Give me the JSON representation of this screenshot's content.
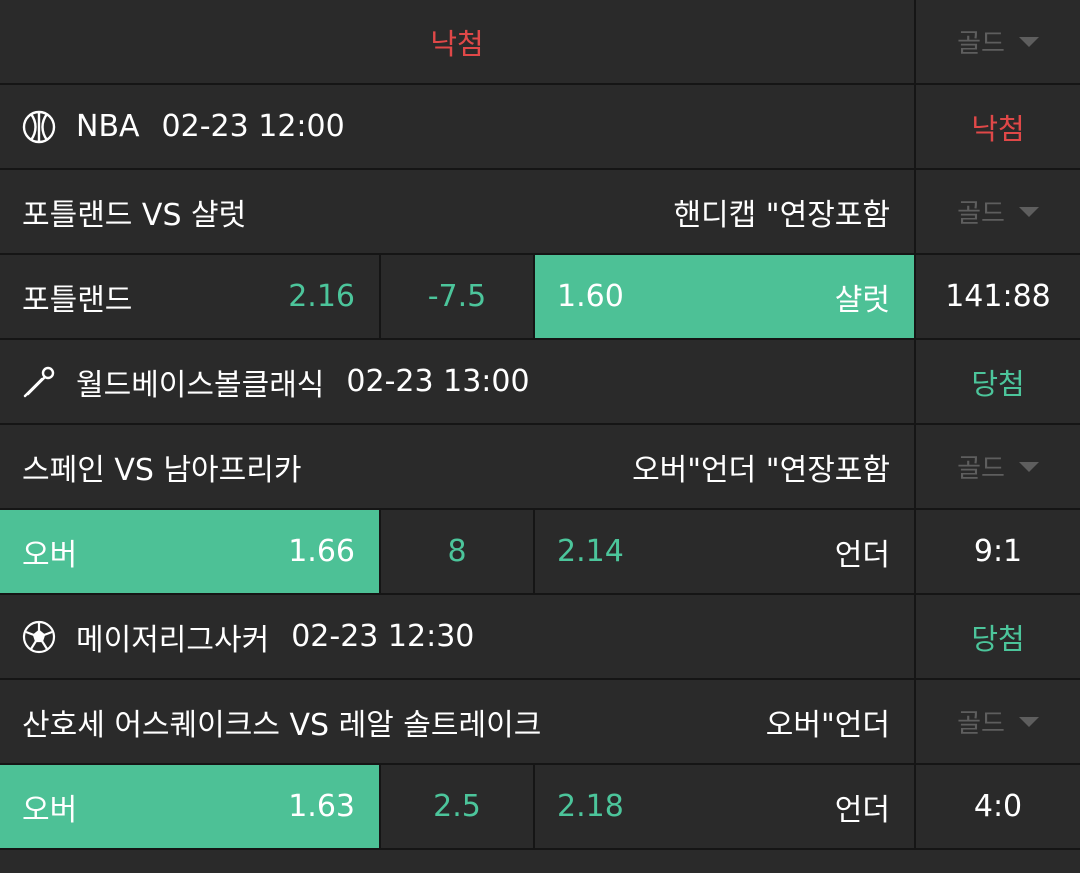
{
  "top": {
    "result": "낙첨",
    "gold": "골드"
  },
  "games": [
    {
      "sport_icon": "basketball-icon",
      "league": "NBA",
      "datetime": "02-23 12:00",
      "status": "낙첨",
      "status_color": "#e04848",
      "match": "포틀랜드 VS 샬럿",
      "market": "핸디캡 \"연장포함",
      "gold": "골드",
      "home_label": "포틀랜드",
      "home_odds": "2.16",
      "line": "-7.5",
      "away_odds": "1.60",
      "away_label": "샬럿",
      "selected": "away",
      "score": "141:88"
    },
    {
      "sport_icon": "baseball-icon",
      "league": "월드베이스볼클래식",
      "datetime": "02-23 13:00",
      "status": "당첨",
      "status_color": "#4cc59b",
      "match": "스페인 VS 남아프리카",
      "market": "오버\"언더 \"연장포함",
      "gold": "골드",
      "home_label": "오버",
      "home_odds": "1.66",
      "line": "8",
      "away_odds": "2.14",
      "away_label": "언더",
      "selected": "home",
      "score": "9:1"
    },
    {
      "sport_icon": "soccer-ball-icon",
      "league": "메이저리그사커",
      "datetime": "02-23 12:30",
      "status": "당첨",
      "status_color": "#4cc59b",
      "match": "산호세 어스퀘이크스 VS 레알 솔트레이크",
      "market": "오버\"언더",
      "gold": "골드",
      "home_label": "오버",
      "home_odds": "1.63",
      "line": "2.5",
      "away_odds": "2.18",
      "away_label": "언더",
      "selected": "home",
      "score": "4:0"
    }
  ]
}
